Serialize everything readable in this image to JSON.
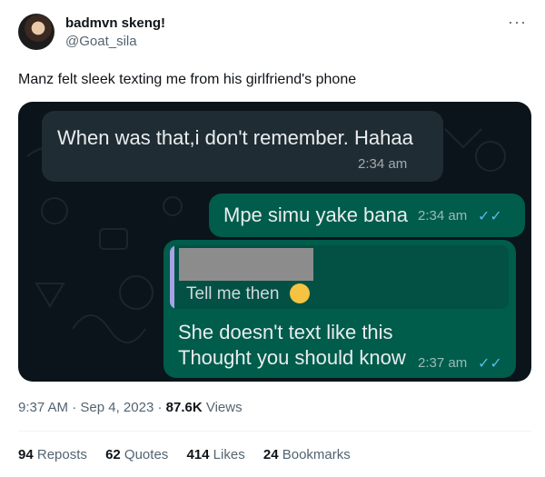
{
  "author": {
    "name": "badmvn skeng!",
    "handle": "@Goat_sila"
  },
  "more_icon": "more-horizontal-icon",
  "tweet_text": "Manz felt sleek texting me from his girlfriend's phone",
  "chat": {
    "incoming": {
      "text": "When was that,i don't remember. Hahaa",
      "time": "2:34 am"
    },
    "outgoing1": {
      "text": "Mpe simu yake bana",
      "time": "2:34 am",
      "ticks": "✓✓"
    },
    "outgoing2": {
      "quoted_text": "Tell me then",
      "line1": "She doesn't text like this",
      "line2": "Thought you should know",
      "time": "2:37 am",
      "ticks": "✓✓"
    },
    "colors": {
      "incoming": "#202c33",
      "outgoing": "#005c4b",
      "ticks": "#53bdeb"
    }
  },
  "meta": {
    "time": "9:37 AM",
    "sep1": "·",
    "date": "Sep 4, 2023",
    "sep2": "·",
    "views_count": "87.6K",
    "views_label": "Views"
  },
  "stats": {
    "reposts_count": "94",
    "reposts_label": "Reposts",
    "quotes_count": "62",
    "quotes_label": "Quotes",
    "likes_count": "414",
    "likes_label": "Likes",
    "bookmarks_count": "24",
    "bookmarks_label": "Bookmarks"
  }
}
